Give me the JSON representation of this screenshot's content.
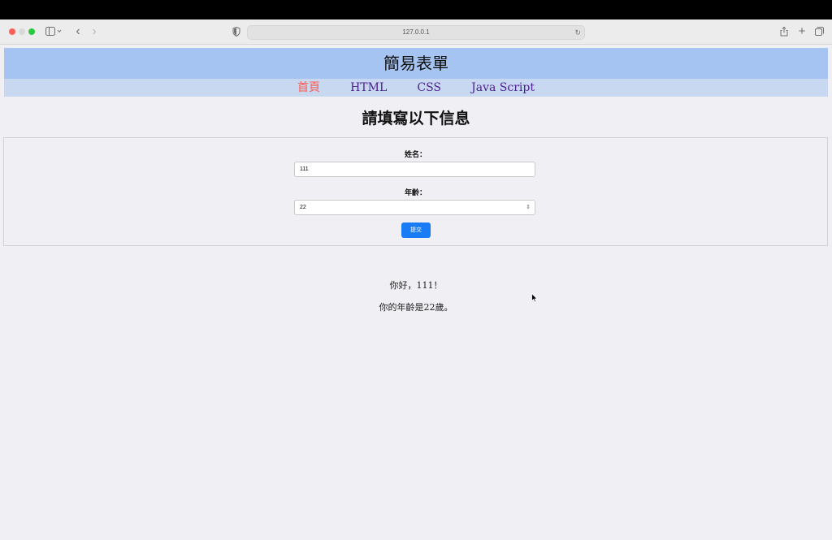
{
  "browser": {
    "url": "127.0.0.1"
  },
  "header": {
    "title": "簡易表單"
  },
  "nav": {
    "items": [
      "首頁",
      "HTML",
      "CSS",
      "Java Script"
    ],
    "active": "首頁"
  },
  "form": {
    "heading": "請填寫以下信息",
    "name_label": "姓名：",
    "name_value": "111",
    "age_label": "年齡：",
    "age_value": "22",
    "submit_label": "提交"
  },
  "result": {
    "greeting": "你好，111！",
    "age_message": "你的年齡是22歲。"
  },
  "colors": {
    "header_bg": "#a5c4f1",
    "nav_bg": "#c8d8f1",
    "nav_active": "#ff5a4f",
    "nav_link": "#4b1f8f",
    "submit_bg": "#1a7cf5",
    "page_bg": "#f0eff4"
  },
  "icons": [
    "sidebar-icon",
    "back-icon",
    "forward-icon",
    "shield-icon",
    "reload-icon",
    "share-icon",
    "new-tab-icon",
    "tabs-overview-icon",
    "cursor-icon"
  ]
}
